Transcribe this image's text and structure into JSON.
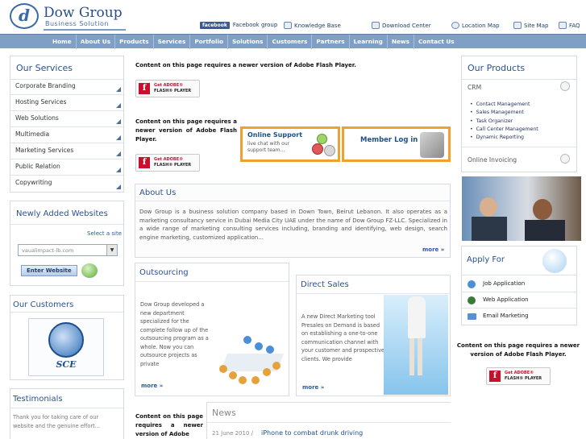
{
  "header": {
    "logo_letter": "d",
    "logo_name": "Dow Group",
    "logo_tagline": "Business Solution",
    "links": {
      "facebook_badge": "facebook",
      "facebook": "Facebook group",
      "knowledge": "Knowledge Base",
      "download": "Download Center",
      "location": "Location Map",
      "sitemap": "Site Map",
      "faq": "FAQ"
    }
  },
  "nav": [
    "Home",
    "About Us",
    "Products",
    "Services",
    "Portfolio",
    "Solutions",
    "Customers",
    "Partners",
    "Learning",
    "News",
    "Contact Us"
  ],
  "services": {
    "title": "Our Services",
    "items": [
      "Corporate Branding",
      "Hosting Services",
      "Web Solutions",
      "Multimedia",
      "Marketing Services",
      "Public Relation",
      "Copywriting"
    ]
  },
  "newly_added": {
    "title": "Newly Added Websites",
    "select_label": "Select a site",
    "selected": "vaualimpact-lb.com",
    "enter_button": "Enter Website"
  },
  "customers": {
    "title": "Our Customers",
    "logo_text": "SCE"
  },
  "testimonials": {
    "title": "Testimonials",
    "text": "Thank you for taking care of our website and the genuine effort..."
  },
  "flash": {
    "message": "Content on this page requires a newer version of Adobe Flash Player.",
    "get": "Get ADOBE®",
    "player": "FLASH® PLAYER",
    "partial": "Content on this page requires a newer version of Adobe"
  },
  "online_support": {
    "title": "Online Support",
    "text": "live chat with our support team..."
  },
  "member_login": {
    "title": "Member Log in"
  },
  "about": {
    "title": "About Us",
    "text": "Dow Group is a business solution company based in Down Town, Beirut Lebanon. It also operates as a marketing consultancy service in Dubai Media City UAE under the name of Dow Group FZ-LLC. Specialized in a wide range of marketing consulting services including, branding and identifying, web design, search engine marketing, customized application...",
    "more": "more »"
  },
  "outsourcing": {
    "title": "Outsourcing",
    "text": "Dow Group developed a new department specialized for the complete follow up of the outsourcing program as a whole. Now you can outsource projects as private",
    "more": "more »"
  },
  "direct_sales": {
    "title": "Direct Sales",
    "text": "A new Direct Marketing tool Presales on Demand is based on establishing a one-to-one communication channel with your customer and prospective clients. We provide",
    "more": "more »"
  },
  "news": {
    "title": "News",
    "date": "21 June 2010 /",
    "headline": "iPhone to combat drunk driving"
  },
  "products": {
    "title": "Our Products",
    "crm": "CRM",
    "crm_items": [
      "Contact Management",
      "Sales Management",
      "Task Organizer",
      "Call Center Management",
      "Dynamic Reporting"
    ],
    "invoicing": "Online Invoicing"
  },
  "apply": {
    "title": "Apply For",
    "items": [
      "Job Application",
      "Web Application",
      "Email Marketing"
    ]
  },
  "colors": {
    "brand": "#2a5290",
    "nav": "#7f9fc7",
    "support_orange": "#f0a030"
  }
}
